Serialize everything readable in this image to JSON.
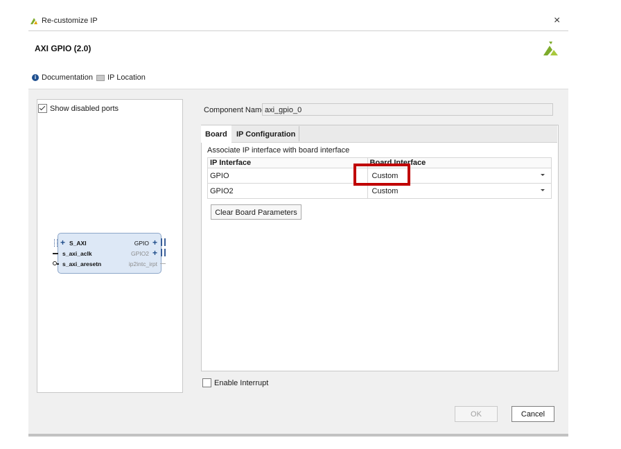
{
  "window": {
    "title": "Re-customize IP",
    "close_symbol": "×",
    "accent": "#7dab2b"
  },
  "header": {
    "ip_title": "AXI GPIO (2.0)",
    "documentation_label": "Documentation",
    "ip_location_label": "IP Location",
    "info_symbol": "i"
  },
  "left_panel": {
    "show_disabled_ports_label": "Show disabled ports",
    "show_disabled_ports_checked": true,
    "block": {
      "left_ports": [
        "S_AXI",
        "s_axi_aclk",
        "s_axi_aresetn"
      ],
      "right_ports": [
        "GPIO",
        "GPIO2",
        "ip2intc_irpt"
      ]
    }
  },
  "component": {
    "label": "Component Name",
    "value": "axi_gpio_0"
  },
  "tabs": [
    {
      "label": "Board"
    },
    {
      "label": "IP Configuration"
    }
  ],
  "board_tab": {
    "description": "Associate IP interface with board interface",
    "columns": [
      "IP Interface",
      "Board Interface"
    ],
    "rows": [
      {
        "ip_interface": "GPIO",
        "board_interface": "Custom"
      },
      {
        "ip_interface": "GPIO2",
        "board_interface": "Custom"
      }
    ],
    "clear_button": "Clear Board Parameters"
  },
  "enable_interrupt": {
    "label": "Enable Interrupt",
    "checked": false
  },
  "footer": {
    "ok": "OK",
    "cancel": "Cancel"
  },
  "colors": {
    "highlight": "#c00000"
  }
}
